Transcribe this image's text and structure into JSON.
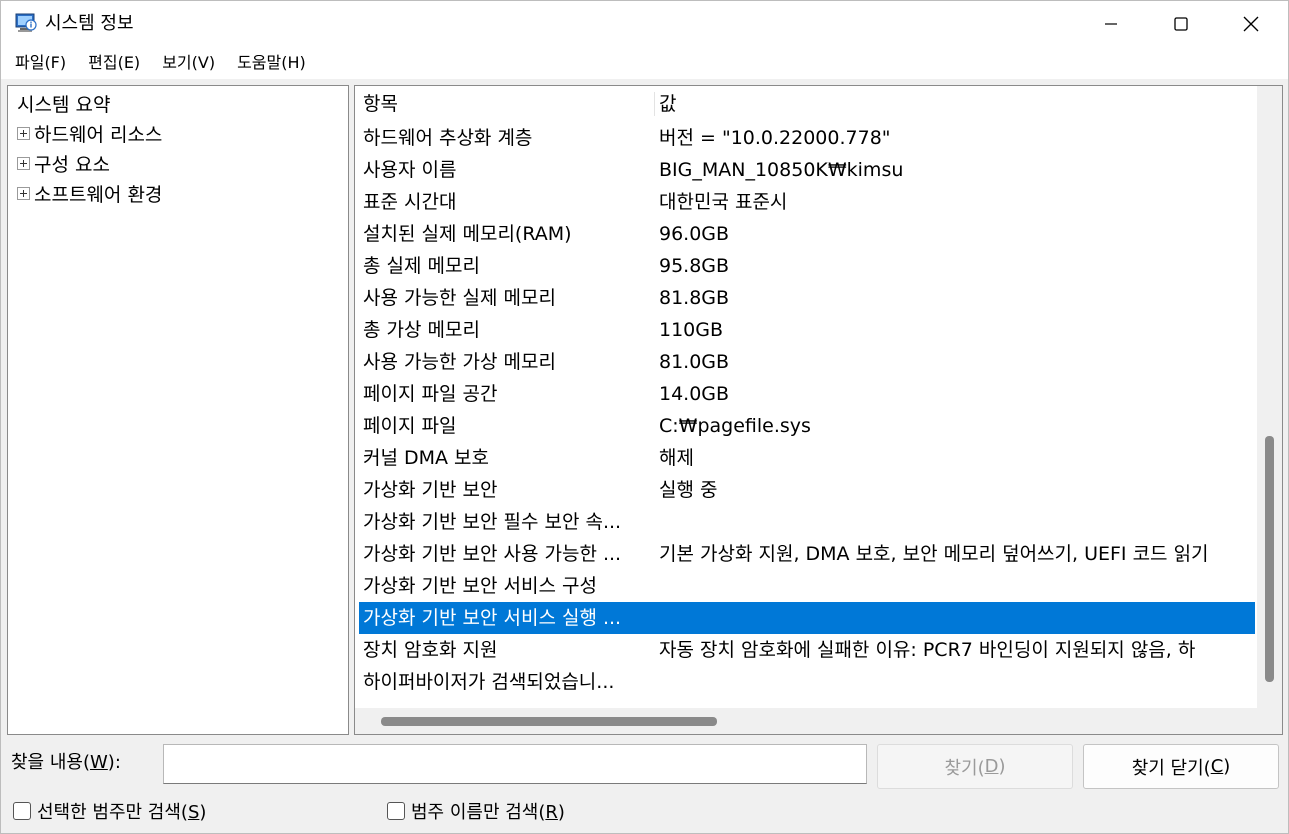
{
  "window": {
    "title": "시스템 정보",
    "icon": "system-info-icon"
  },
  "menu": [
    {
      "label": "파일(F)"
    },
    {
      "label": "편집(E)"
    },
    {
      "label": "보기(V)"
    },
    {
      "label": "도움말(H)"
    }
  ],
  "tree": {
    "root": "시스템 요약",
    "children": [
      {
        "label": "하드웨어 리소스"
      },
      {
        "label": "구성 요소"
      },
      {
        "label": "소프트웨어 환경"
      }
    ]
  },
  "list": {
    "headers": {
      "item": "항목",
      "value": "값"
    },
    "selected_index": 15,
    "rows": [
      {
        "item": "하드웨어 추상화 계층",
        "value": "버전 = \"10.0.22000.778\""
      },
      {
        "item": "사용자 이름",
        "value": "BIG_MAN_10850K₩kimsu"
      },
      {
        "item": "표준 시간대",
        "value": "대한민국 표준시"
      },
      {
        "item": "설치된 실제 메모리(RAM)",
        "value": "96.0GB"
      },
      {
        "item": "총 실제 메모리",
        "value": "95.8GB"
      },
      {
        "item": "사용 가능한 실제 메모리",
        "value": "81.8GB"
      },
      {
        "item": "총 가상 메모리",
        "value": "110GB"
      },
      {
        "item": "사용 가능한 가상 메모리",
        "value": "81.0GB"
      },
      {
        "item": "페이지 파일 공간",
        "value": "14.0GB"
      },
      {
        "item": "페이지 파일",
        "value": "C:₩pagefile.sys"
      },
      {
        "item": "커널 DMA 보호",
        "value": "해제"
      },
      {
        "item": "가상화 기반 보안",
        "value": "실행 중"
      },
      {
        "item": "가상화 기반 보안 필수 보안 속...",
        "value": ""
      },
      {
        "item": "가상화 기반 보안 사용 가능한 ...",
        "value": "기본 가상화 지원, DMA 보호, 보안 메모리 덮어쓰기, UEFI 코드 읽기"
      },
      {
        "item": "가상화 기반 보안 서비스 구성",
        "value": ""
      },
      {
        "item": "가상화 기반 보안 서비스 실행 ...",
        "value": ""
      },
      {
        "item": "장치 암호화 지원",
        "value": "자동 장치 암호화에 실패한 이유: PCR7 바인딩이 지원되지 않음, 하"
      },
      {
        "item": "하이퍼바이저가 검색되었습니...",
        "value": ""
      }
    ]
  },
  "find": {
    "label_prefix": "찾을 내용(",
    "label_key": "W",
    "label_suffix": "):",
    "input_value": "",
    "find_button_prefix": "찾기(",
    "find_button_key": "D",
    "find_button_suffix": ")",
    "close_button_prefix": "찾기 닫기(",
    "close_button_key": "C",
    "close_button_suffix": ")",
    "check1_prefix": "선택한 범주만 검색(",
    "check1_key": "S",
    "check1_suffix": ")",
    "check2_prefix": "범주 이름만 검색(",
    "check2_key": "R",
    "check2_suffix": ")",
    "check1_checked": false,
    "check2_checked": false
  },
  "colors": {
    "selection": "#0078d7",
    "disabled_text": "#9a9a9a"
  }
}
